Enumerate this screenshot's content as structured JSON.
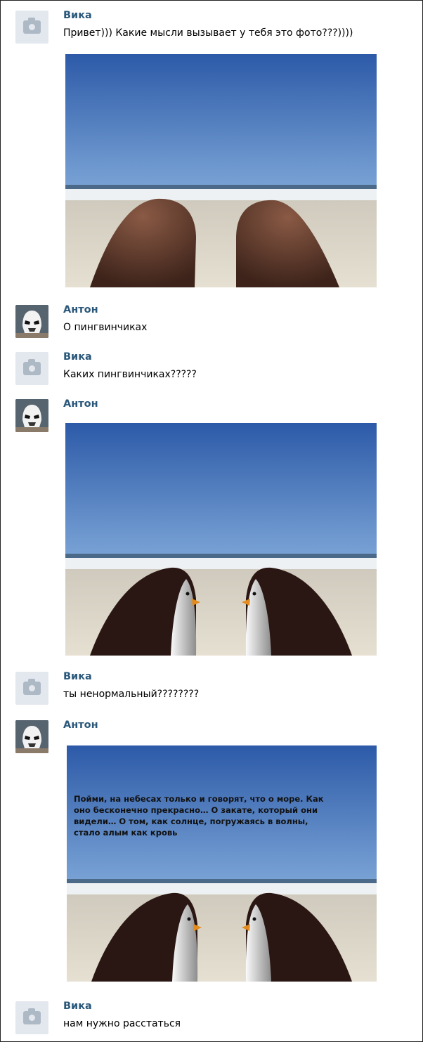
{
  "messages": [
    {
      "author": "Вика",
      "text": "Привет))) Какие мысли вызывает у тебя это фото???))))",
      "avatar": "camera-placeholder",
      "attachment": "photo-beach-legs"
    },
    {
      "author": "Антон",
      "text": "О пингвинчиках",
      "avatar": "stormtrooper"
    },
    {
      "author": "Вика",
      "text": "Каких пингвинчиках?????",
      "avatar": "camera-placeholder"
    },
    {
      "author": "Антон",
      "text": "",
      "avatar": "stormtrooper",
      "attachment": "photo-beach-penguins"
    },
    {
      "author": "Вика",
      "text": "ты ненормальный????????",
      "avatar": "camera-placeholder"
    },
    {
      "author": "Антон",
      "text": "",
      "avatar": "stormtrooper",
      "attachment": "photo-beach-penguins-caption"
    },
    {
      "author": "Вика",
      "text": "нам нужно расстаться",
      "avatar": "camera-placeholder"
    }
  ],
  "photo_caption": {
    "line1": "Пойми, на небесах только и говорят, что о море. Как",
    "line2": "оно бесконечно прекрасно… О закате, который они",
    "line3": "видели… О том, как солнце, погружаясь в волны,",
    "line4": "стало алым как кровь"
  },
  "colors": {
    "name": "#2b587a",
    "text": "#000000",
    "avatar_placeholder": "#e3e8ee"
  }
}
